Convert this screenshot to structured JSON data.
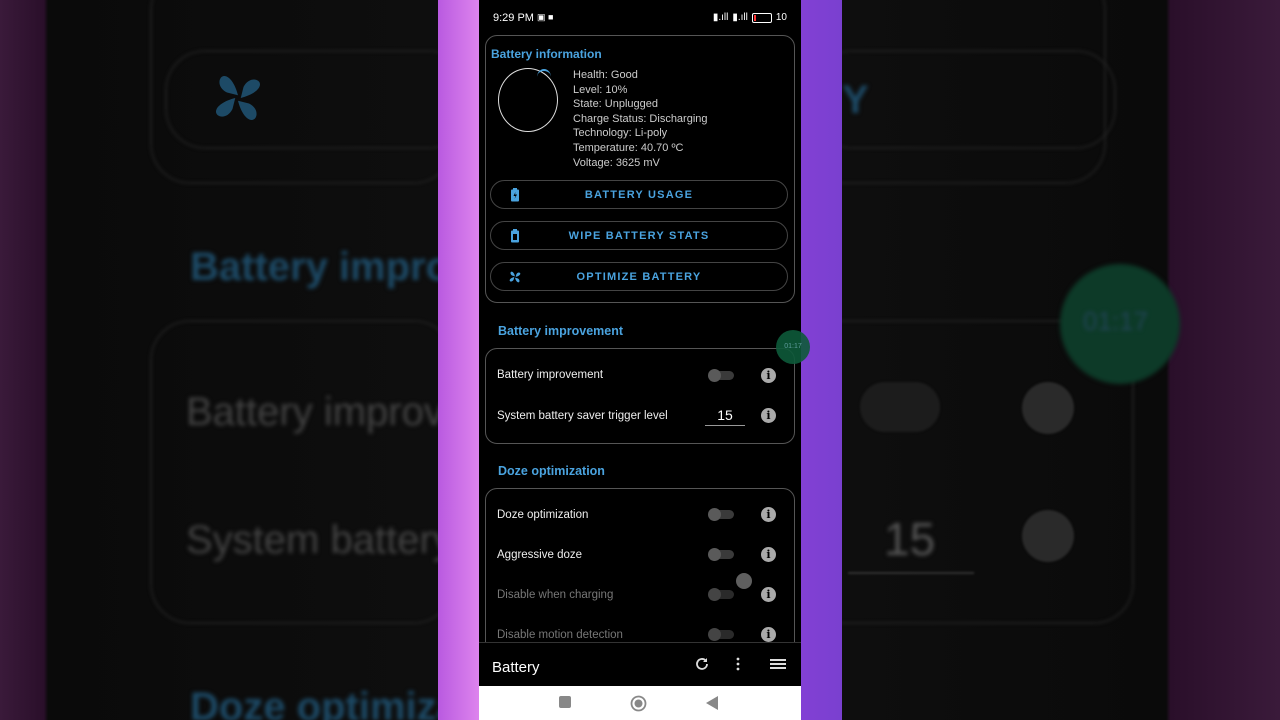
{
  "status": {
    "time": "9:29 PM",
    "battery_pct": "10"
  },
  "battery_info": {
    "title": "Battery information",
    "lines": [
      "Health: Good",
      "Level: 10%",
      "State: Unplugged",
      "Charge Status: Discharging",
      "Technology: Li-poly",
      "Temperature: 40.70 ºC",
      "Voltage: 3625 mV"
    ],
    "level_fraction": 0.1,
    "buttons": {
      "usage": "BATTERY USAGE",
      "wipe": "WIPE BATTERY STATS",
      "optimize": "OPTIMIZE BATTERY"
    }
  },
  "battery_improvement": {
    "title": "Battery improvement",
    "rows": {
      "improvement": "Battery improvement",
      "saver": "System battery saver trigger level"
    },
    "saver_value": "15"
  },
  "doze": {
    "title": "Doze optimization",
    "rows": {
      "doze": "Doze optimization",
      "aggressive": "Aggressive doze",
      "charging": "Disable when charging",
      "motion": "Disable motion detection"
    }
  },
  "timer": "01:17",
  "appbar": {
    "title": "Battery"
  },
  "colors": {
    "accent": "#4aa3df",
    "wallpaper": "#b95ae0"
  },
  "icons": {
    "battery_usage": "battery-icon",
    "wipe": "battery-icon",
    "optimize": "fan-icon",
    "refresh": "refresh-icon",
    "more": "more-vert-icon",
    "menu": "menu-icon"
  }
}
